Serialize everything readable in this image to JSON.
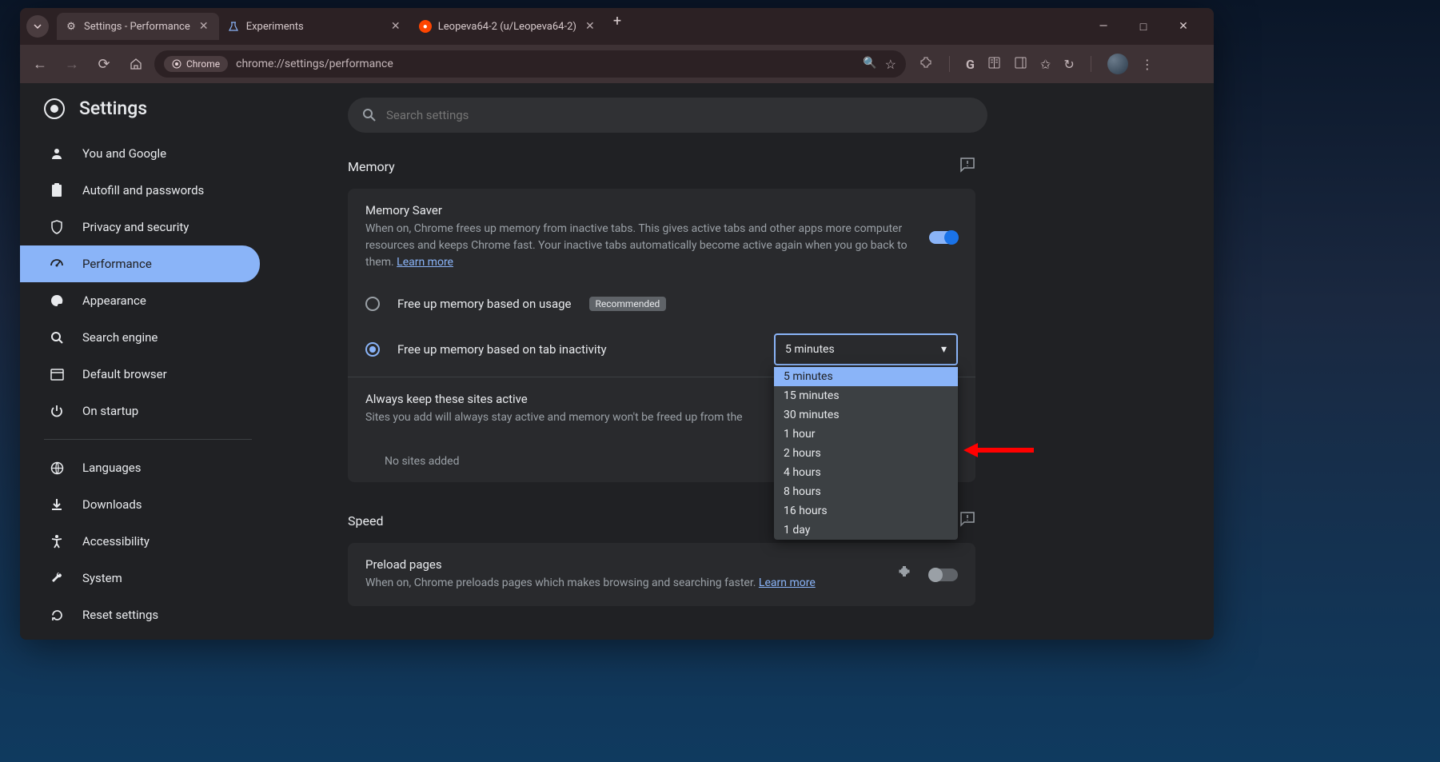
{
  "window": {
    "tabs": [
      {
        "title": "Settings - Performance",
        "icon": "gear",
        "active": true
      },
      {
        "title": "Experiments",
        "icon": "flask",
        "active": false
      },
      {
        "title": "Leopeva64-2 (u/Leopeva64-2)",
        "icon": "reddit",
        "active": false
      }
    ],
    "controls": {
      "min": "—",
      "max": "□",
      "close": "✕"
    }
  },
  "addressbar": {
    "chip": "Chrome",
    "url": "chrome://settings/performance"
  },
  "settings_title": "Settings",
  "search_placeholder": "Search settings",
  "sidebar": {
    "items": [
      {
        "icon": "person",
        "label": "You and Google"
      },
      {
        "icon": "clipboard",
        "label": "Autofill and passwords"
      },
      {
        "icon": "shield",
        "label": "Privacy and security"
      },
      {
        "icon": "gauge",
        "label": "Performance",
        "active": true
      },
      {
        "icon": "palette",
        "label": "Appearance"
      },
      {
        "icon": "search",
        "label": "Search engine"
      },
      {
        "icon": "browser",
        "label": "Default browser"
      },
      {
        "icon": "power",
        "label": "On startup"
      }
    ],
    "items2": [
      {
        "icon": "globe",
        "label": "Languages"
      },
      {
        "icon": "download",
        "label": "Downloads"
      },
      {
        "icon": "accessibility",
        "label": "Accessibility"
      },
      {
        "icon": "wrench",
        "label": "System"
      },
      {
        "icon": "reset",
        "label": "Reset settings"
      }
    ]
  },
  "memory": {
    "section": "Memory",
    "title": "Memory Saver",
    "desc": "When on, Chrome frees up memory from inactive tabs. This gives active tabs and other apps more computer resources and keeps Chrome fast. Your inactive tabs automatically become active again when you go back to them. ",
    "learn_more": "Learn more",
    "radio1": "Free up memory based on usage",
    "recommended": "Recommended",
    "radio2": "Free up memory based on tab inactivity",
    "select_value": "5 minutes",
    "options": [
      "5 minutes",
      "15 minutes",
      "30 minutes",
      "1 hour",
      "2 hours",
      "4 hours",
      "8 hours",
      "16 hours",
      "1 day"
    ],
    "always_title": "Always keep these sites active",
    "always_desc": "Sites you add will always stay active and memory won't be freed up from the",
    "no_sites": "No sites added"
  },
  "speed": {
    "section": "Speed",
    "title": "Preload pages",
    "desc": "When on, Chrome preloads pages which makes browsing and searching faster. ",
    "learn_more": "Learn more"
  }
}
